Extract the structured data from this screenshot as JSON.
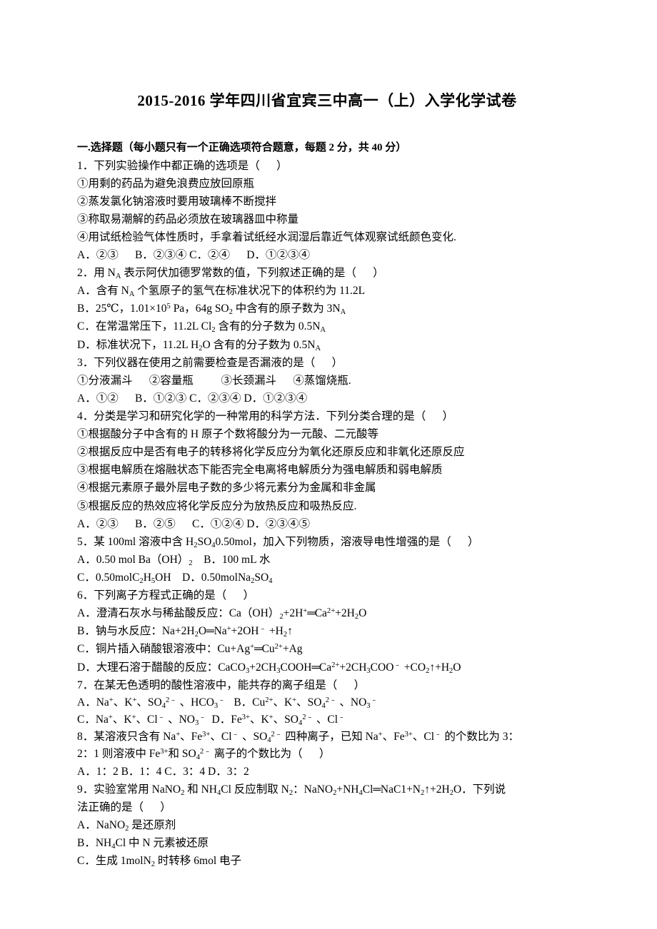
{
  "document": {
    "title": "2015-2016 学年四川省宜宾三中高一（上）入学化学试卷",
    "section_heading": "一.选择题（每小题只有一个正确选项符合题意，每题 2 分，共 40 分）"
  },
  "questions": [
    {
      "stem": "1．下列实验操作中都正确的选项是（      ）",
      "items": [
        "①用剩的药品为避免浪费应放回原瓶",
        "②蒸发氯化钠溶液时要用玻璃棒不断搅拌",
        "③称取易潮解的药品必须放在玻璃器皿中称量",
        "④用试纸检验气体性质时，手拿着试纸经水润湿后靠近气体观察试纸颜色变化."
      ],
      "choices_line": "A．②③      B．②③④ C．②④      D．①②③④"
    },
    {
      "stem_html": "2．用 N<sub>A</sub> 表示阿伏加德罗常数的值，下列叙述正确的是（      ）",
      "options_html": [
        "A．含有 N<sub>A</sub> 个氢原子的氢气在标准状况下的体积约为 11.2L",
        "B．25℃，1.01×10<sup>5</sup> Pa，64g SO<sub>2</sub> 中含有的原子数为 3N<sub>A</sub>",
        "C．在常温常压下，11.2L Cl<sub>2</sub> 含有的分子数为 0.5N<sub>A</sub>",
        "D．标准状况下，11.2L H<sub>2</sub>O 含有的分子数为 0.5N<sub>A</sub>"
      ]
    },
    {
      "stem": "3．下列仪器在使用之前需要检查是否漏液的是（      ）",
      "items": [
        "①分液漏斗      ②容量瓶          ③长颈漏斗      ④蒸馏烧瓶."
      ],
      "choices_line": "A．①②      B．①②③ C．②③④ D．①②③④"
    },
    {
      "stem": "4．分类是学习和研究化学的一种常用的科学方法．下列分类合理的是（      ）",
      "items": [
        "①根据酸分子中含有的 H 原子个数将酸分为一元酸、二元酸等",
        "②根据反应中是否有电子的转移将化学反应分为氧化还原反应和非氧化还原反应",
        "③根据电解质在熔融状态下能否完全电离将电解质分为强电解质和弱电解质",
        "④根据元素原子最外层电子数的多少将元素分为金属和非金属",
        "⑤根据反应的热效应将化学反应分为放热反应和吸热反应."
      ],
      "choices_line": "A．②③      B．②⑤      C．①②④ D．②③④⑤"
    },
    {
      "stem_html": "5．某 100ml 溶液中含 H<sub>2</sub>SO<sub>4</sub>0.50mol，加入下列物质，溶液导电性增强的是（      ）",
      "options_html": [
        "A．0.50 mol Ba（OH）<sub>2</sub>    B．100 mL 水",
        "C．0.50molC<sub>2</sub>H<sub>5</sub>OH    D．0.50molNa<sub>2</sub>SO<sub>4</sub>"
      ]
    },
    {
      "stem": "6．下列离子方程式正确的是（      ）",
      "options_html": [
        "A．澄清石灰水与稀盐酸反应：Ca（OH）<sub>2</sub>+2H<sup>+</sup><span class=\"eq\">═</span>Ca<sup>2+</sup>+2H<sub>2</sub>O",
        "B．钠与水反应：Na+2H<sub>2</sub>O<span class=\"eq\">═</span>Na<sup>+</sup>+2OH<sup>﹣</sup> +H<sub>2</sub>↑",
        "C．铜片插入硝酸银溶液中：Cu+Ag<sup>+</sup><span class=\"eq\">═</span>Cu<sup>2+</sup>+Ag",
        "D．大理石溶于醋酸的反应：CaCO<sub>3</sub>+2CH<sub>3</sub>COOH<span class=\"eq\">═</span>Ca<sup>2+</sup>+2CH<sub>3</sub>COO<sup>﹣</sup> +CO<sub>2</sub>↑+H<sub>2</sub>O"
      ]
    },
    {
      "stem": "7．在某无色透明的酸性溶液中，能共存的离子组是（      ）",
      "options_html": [
        "A．Na<sup>+</sup>、K<sup>+</sup>、SO<sub>4</sub><sup>2﹣</sup> 、HCO<sub>3</sub><sup>﹣</sup>   B．Cu<sup>2+</sup>、K<sup>+</sup>、SO<sub>4</sub><sup>2﹣</sup> 、NO<sub>3</sub><sup>﹣</sup>",
        "C．Na<sup>+</sup>、K<sup>+</sup>、Cl<sup>﹣</sup> 、NO<sub>3</sub><sup>﹣</sup>  D．Fe<sup>3+</sup>、K<sup>+</sup>、SO<sub>4</sub><sup>2﹣</sup> 、Cl<sup>﹣</sup>"
      ]
    },
    {
      "stem_html_lines": [
        "8．某溶液只含有 Na<sup>+</sup>、Fe<sup>3+</sup>、Cl<sup>﹣</sup> 、SO<sub>4</sub><sup>2﹣</sup> 四种离子，已知 Na<sup>+</sup>、Fe<sup>3+</sup>、Cl<sup>﹣</sup> 的个数比为 3：",
        "2：1 则溶液中 Fe<sup>3+</sup>和 SO<sub>4</sub><sup>2﹣</sup> 离子的个数比为（      ）"
      ],
      "choices_line": "A．1：2 B．1：4 C．3：4 D．3：2"
    },
    {
      "stem_html_lines": [
        "9．实验室常用 NaNO<sub>2</sub> 和 NH<sub>4</sub>Cl 反应制取 N<sub>2</sub>：NaNO<sub>2</sub>+NH<sub>4</sub>Cl<span class=\"eq\">═</span>NaC1+N<sub>2</sub>↑+2H<sub>2</sub>O．下列说",
        "法正确的是（      ）"
      ],
      "options_html": [
        "A．NaNO<sub>2</sub> 是还原剂",
        "B．NH<sub>4</sub>Cl 中 N 元素被还原",
        "C．生成 1molN<sub>2</sub> 时转移 6mol 电子"
      ]
    }
  ]
}
